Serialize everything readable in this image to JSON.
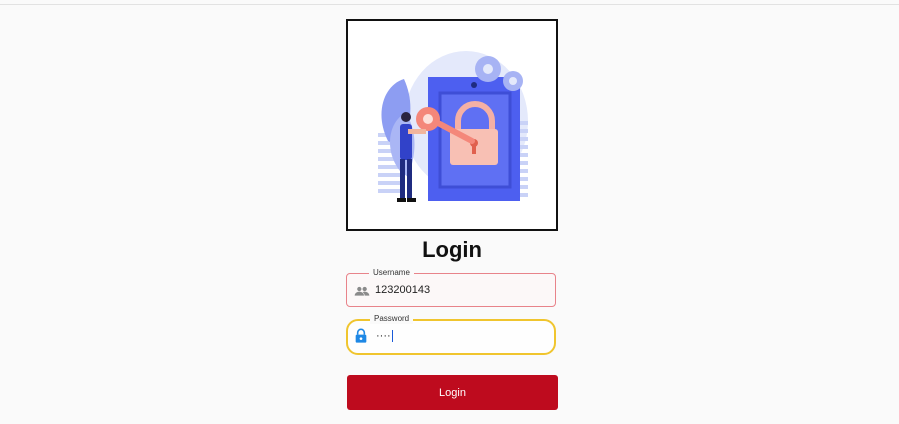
{
  "page": {
    "title": "Login"
  },
  "form": {
    "username": {
      "label": "Username",
      "value": "123200143",
      "icon": "people-icon"
    },
    "password": {
      "label": "Password",
      "masked_value": "····",
      "icon": "lock-icon"
    },
    "submit_label": "Login"
  },
  "colors": {
    "primary": "#be0b1e",
    "username_border": "#e8838a",
    "password_border_focused": "#f0c52e",
    "illustration_blue": "#4d5ff0",
    "illustration_accent": "#f08a7c"
  },
  "illustration": {
    "name": "person-unlocking-padlock-illustration"
  }
}
